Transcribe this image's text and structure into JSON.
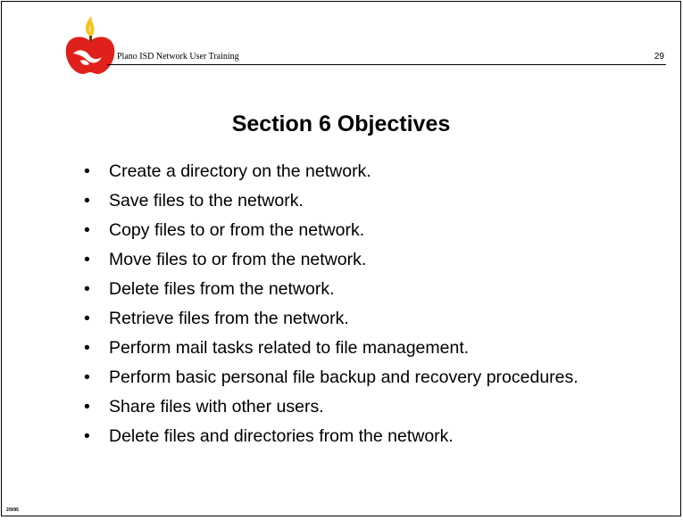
{
  "header": {
    "title": "Plano ISD Network User Training",
    "page_number": "29"
  },
  "slide": {
    "title": "Section 6 Objectives",
    "bullets": [
      "Create a directory on the network.",
      "Save files to the network.",
      "Copy files to or from the network.",
      "Move files to or from the network.",
      "Delete files from the network.",
      "Retrieve files from the network.",
      "Perform mail tasks related to file management.",
      "Perform basic personal file backup and recovery procedures.",
      "Share files with other users.",
      "Delete files and directories from the network."
    ]
  },
  "footer": {
    "date": "2/9/95"
  },
  "colors": {
    "apple": "#e0211b",
    "flame": "#f6c21c",
    "text": "#000000"
  },
  "icons": {
    "logo": "apple-logo-icon"
  }
}
